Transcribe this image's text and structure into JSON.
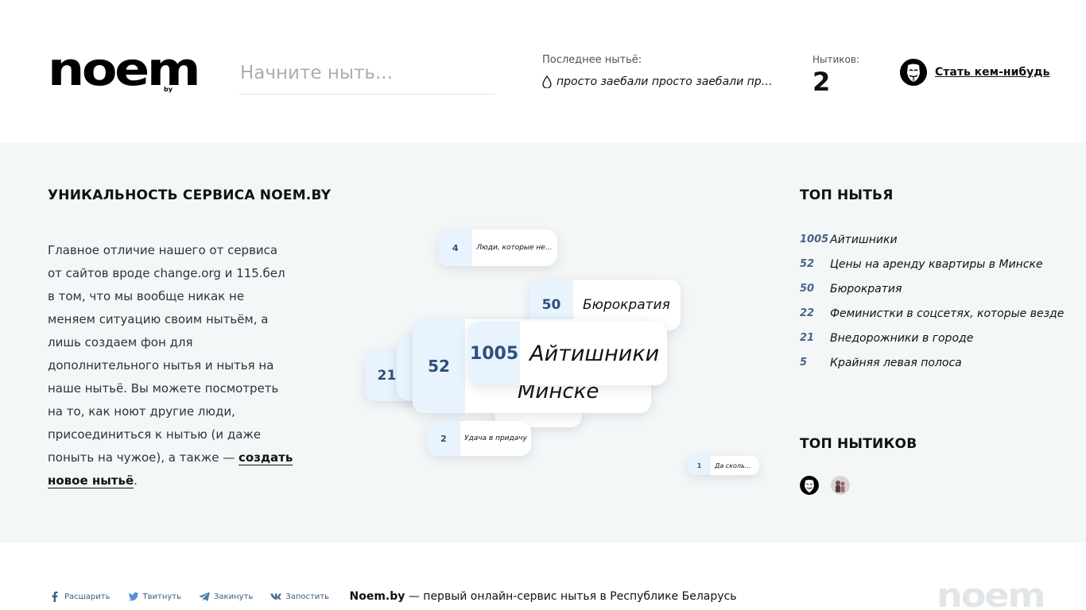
{
  "header": {
    "logo": "noem",
    "logo_sub": "by",
    "search_placeholder": "Начните ныть...",
    "last_label": "Последнее нытьё:",
    "last_text": "просто заебали просто заебали прост...",
    "count_label": "Нытиков:",
    "count_value": "2",
    "become_label": "Стать кем-нибудь"
  },
  "about": {
    "title": "УНИКАЛЬНОСТЬ СЕРВИСА NOEM.BY",
    "text": "Главное отличие нашего от сервиса от сайтов вроде change.org и 115.бел в том, что мы вообще никак не меняем ситуацию своим нытьём, а лишь создаем фон для дополнительного нытья и нытья на наше нытьё. Вы можете посмотреть на то, как ноют другие люди, присоединиться к нытью (и даже поныть на чужое), а также — ",
    "link": "создать новое нытьё",
    "after": "."
  },
  "cloud": [
    {
      "n": "4",
      "label": "Люди, которые не..."
    },
    {
      "n": "50",
      "label": "Бюрократия"
    },
    {
      "n": "21",
      "label": ""
    },
    {
      "n": "2",
      "label": ""
    },
    {
      "n": "52",
      "label": "Минске"
    },
    {
      "n": "1005",
      "label": "Айтишники"
    },
    {
      "n": "2",
      "label": "Удача в придачу"
    },
    {
      "n": "1",
      "label": "Да сколь..."
    }
  ],
  "top": {
    "title": "ТОП НЫТЬЯ",
    "items": [
      {
        "n": "1005",
        "t": "Айтишники"
      },
      {
        "n": "52",
        "t": "Цены на аренду квартиры в Минске"
      },
      {
        "n": "50",
        "t": "Бюрократия"
      },
      {
        "n": "22",
        "t": "Феминистки в соцсетях, которые везде"
      },
      {
        "n": "21",
        "t": "Внедорожники в городе"
      },
      {
        "n": "5",
        "t": "Крайняя левая полоса"
      }
    ]
  },
  "users": {
    "title": "ТОП НЫТИКОВ"
  },
  "footer": {
    "share": [
      "Расшарить",
      "Твитнуть",
      "Закинуть",
      "Запостить"
    ],
    "tagline_bold": "Noem.by",
    "tagline_rest": " — первый онлайн-сервис нытья в Республике Беларусь",
    "logo": "noem"
  },
  "colors": {
    "accent_num": "#2f4e7a",
    "num_bg": "#e8f3fd",
    "main_bg": "#f4f7f8"
  }
}
